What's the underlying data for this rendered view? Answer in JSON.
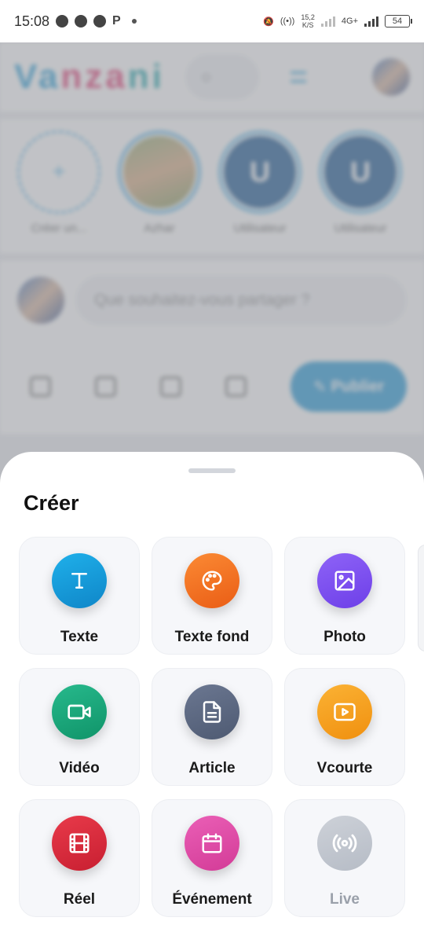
{
  "status_bar": {
    "time": "15:08",
    "speed_top": "15,2",
    "speed_unit": "K/S",
    "network": "4G+",
    "battery": "54"
  },
  "app": {
    "brand_parts": [
      "Va",
      "nza",
      "ni"
    ],
    "composer_placeholder": "Que souhaitez-vous partager ?",
    "publish_label": "Publier",
    "stories": [
      {
        "label": "Créer un...",
        "initial": "+"
      },
      {
        "label": "Azhar",
        "initial": ""
      },
      {
        "label": "Utilisateur",
        "initial": "U"
      },
      {
        "label": "Utilisateur",
        "initial": "U"
      }
    ]
  },
  "sheet": {
    "title": "Créer",
    "items": [
      {
        "label": "Texte",
        "icon": "text-icon",
        "color_from": "#1fb0ea",
        "color_to": "#0f86c8"
      },
      {
        "label": "Texte fond",
        "icon": "palette-icon",
        "color_from": "#fb8a34",
        "color_to": "#ea5d15"
      },
      {
        "label": "Photo",
        "icon": "image-icon",
        "color_from": "#8e63f7",
        "color_to": "#6d3fe8"
      },
      {
        "label": "Vidéo",
        "icon": "video-icon",
        "color_from": "#27b98c",
        "color_to": "#109469"
      },
      {
        "label": "Article",
        "icon": "document-icon",
        "color_from": "#6b7791",
        "color_to": "#4e5a72"
      },
      {
        "label": "Vcourte",
        "icon": "play-square-icon",
        "color_from": "#fbb234",
        "color_to": "#f0900f"
      },
      {
        "label": "Réel",
        "icon": "film-icon",
        "color_from": "#e83a4a",
        "color_to": "#c81f31"
      },
      {
        "label": "Événement",
        "icon": "calendar-icon",
        "color_from": "#ea5fb6",
        "color_to": "#d33b97"
      },
      {
        "label": "Live",
        "icon": "broadcast-icon",
        "color_from": "#cdd1d8",
        "color_to": "#b6bcc6"
      }
    ]
  }
}
